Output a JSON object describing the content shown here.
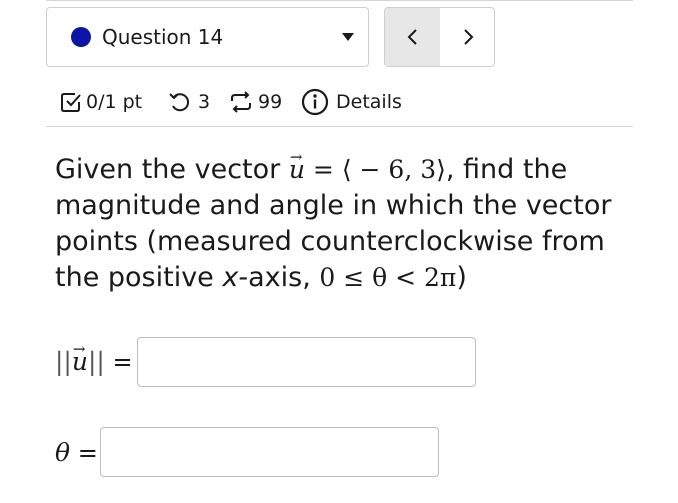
{
  "question_nav": {
    "selected_question": "Question 14",
    "status_color": "#0b16a6",
    "prev_icon": "chevron-left-icon",
    "next_icon": "chevron-right-icon"
  },
  "meta": {
    "score": "0/1 pt",
    "attempts_remaining": "3",
    "versions_remaining": "99",
    "details_label": "Details"
  },
  "question": {
    "lead": "Given the vector",
    "vector_symbol": "u",
    "equals": "=",
    "vector_value": "⟨ − 6, 3⟩",
    "middle": ", find the magnitude and angle in which the vector points (measured counterclockwise from the positive",
    "axis_word": "x",
    "axis_suffix": "-axis,",
    "range_expr": "0 ≤ θ < 2π",
    "end": ")"
  },
  "answers": {
    "magnitude_label_open": "||",
    "magnitude_label_close": "||",
    "magnitude_equals": "=",
    "magnitude_value": "",
    "angle_label": "θ",
    "angle_equals": "=",
    "angle_value": ""
  }
}
